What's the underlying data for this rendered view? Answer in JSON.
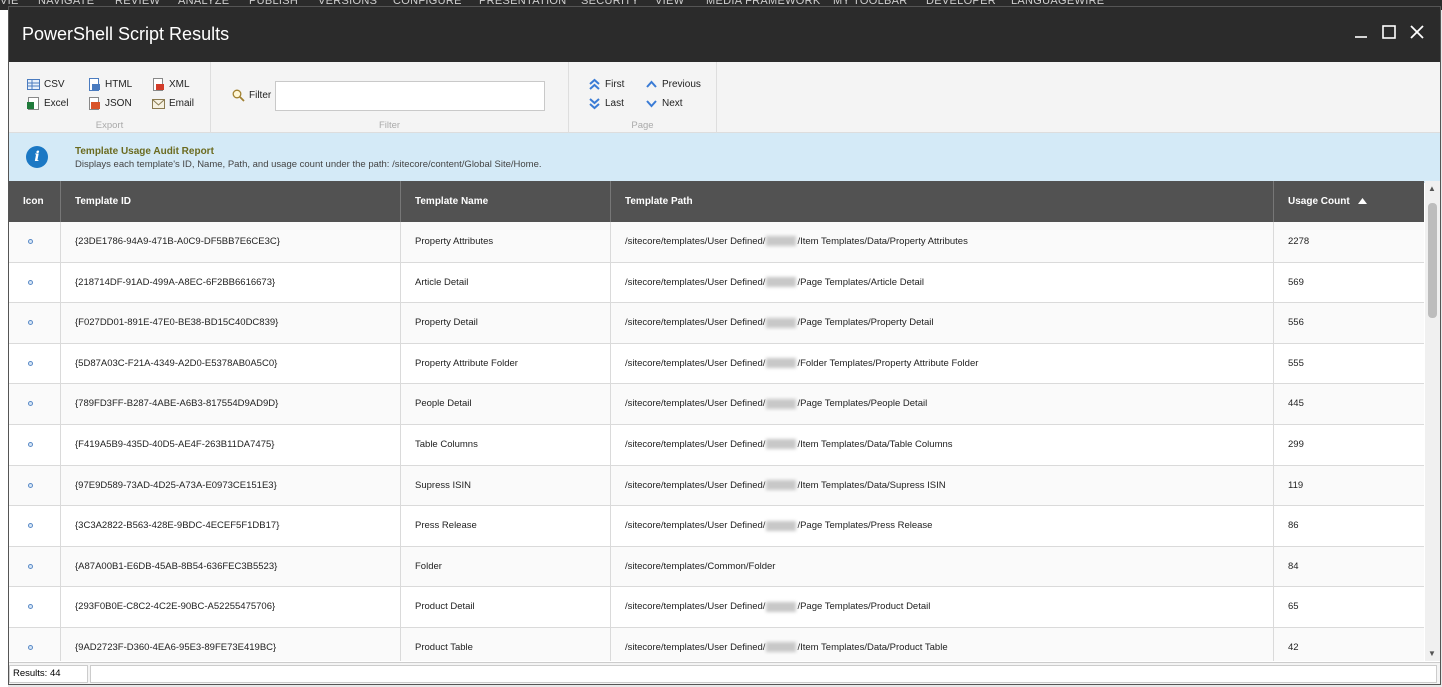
{
  "background_menu": [
    "VIE",
    "NAVIGATE",
    "REVIEW",
    "ANALYZE",
    "PUBLISH",
    "VERSIONS",
    "CONFIGURE",
    "PRESENTATION",
    "SECURITY",
    "VIEW",
    "MEDIA FRAMEWORK",
    "MY TOOLBAR",
    "DEVELOPER",
    "LANGUAGEWIRE"
  ],
  "window": {
    "title": "PowerShell Script Results",
    "minimize_icon": "minimize-icon",
    "maximize_icon": "maximize-icon",
    "close_icon": "close-icon"
  },
  "toolbar": {
    "export": {
      "label": "Export",
      "buttons": [
        {
          "label": "CSV",
          "icon": "csv-icon"
        },
        {
          "label": "HTML",
          "icon": "html-icon"
        },
        {
          "label": "XML",
          "icon": "xml-icon"
        },
        {
          "label": "Excel",
          "icon": "excel-icon"
        },
        {
          "label": "JSON",
          "icon": "json-icon"
        },
        {
          "label": "Email",
          "icon": "email-icon"
        }
      ]
    },
    "filter": {
      "label": "Filter",
      "button_label": "Filter",
      "value": "",
      "placeholder": ""
    },
    "page": {
      "label": "Page",
      "first": "First",
      "last": "Last",
      "previous": "Previous",
      "next": "Next"
    }
  },
  "info": {
    "title": "Template Usage Audit Report",
    "description": "Displays each template's ID, Name, Path, and usage count under the path: /sitecore/content/Global Site/Home."
  },
  "grid": {
    "columns": [
      "Icon",
      "Template ID",
      "Template Name",
      "Template Path",
      "Usage Count"
    ],
    "sort_column": "Usage Count",
    "sort_direction": "ascending",
    "rows": [
      {
        "id": "{23DE1786-94A9-471B-A0C9-DF5BB7E6CE3C}",
        "name": "Property Attributes",
        "path_pre": "/sitecore/templates/User Defined/",
        "path_post": "/Item Templates/Data/Property Attributes",
        "redacted": true,
        "count": "2278"
      },
      {
        "id": "{218714DF-91AD-499A-A8EC-6F2BB6616673}",
        "name": "Article Detail",
        "path_pre": "/sitecore/templates/User Defined/",
        "path_post": "/Page Templates/Article Detail",
        "redacted": true,
        "count": "569"
      },
      {
        "id": "{F027DD01-891E-47E0-BE38-BD15C40DC839}",
        "name": "Property Detail",
        "path_pre": "/sitecore/templates/User Defined/",
        "path_post": "/Page Templates/Property Detail",
        "redacted": true,
        "count": "556"
      },
      {
        "id": "{5D87A03C-F21A-4349-A2D0-E5378AB0A5C0}",
        "name": "Property Attribute Folder",
        "path_pre": "/sitecore/templates/User Defined/",
        "path_post": "/Folder Templates/Property Attribute Folder",
        "redacted": true,
        "count": "555"
      },
      {
        "id": "{789FD3FF-B287-4ABE-A6B3-817554D9AD9D}",
        "name": "People Detail",
        "path_pre": "/sitecore/templates/User Defined/",
        "path_post": "/Page Templates/People Detail",
        "redacted": true,
        "count": "445"
      },
      {
        "id": "{F419A5B9-435D-40D5-AE4F-263B11DA7475}",
        "name": "Table Columns",
        "path_pre": "/sitecore/templates/User Defined/",
        "path_post": "/Item Templates/Data/Table Columns",
        "redacted": true,
        "count": "299"
      },
      {
        "id": "{97E9D589-73AD-4D25-A73A-E0973CE151E3}",
        "name": "Supress ISIN",
        "path_pre": "/sitecore/templates/User Defined/",
        "path_post": "/Item Templates/Data/Supress ISIN",
        "redacted": true,
        "count": "119"
      },
      {
        "id": "{3C3A2822-B563-428E-9BDC-4ECEF5F1DB17}",
        "name": "Press Release",
        "path_pre": "/sitecore/templates/User Defined/",
        "path_post": "/Page Templates/Press Release",
        "redacted": true,
        "count": "86"
      },
      {
        "id": "{A87A00B1-E6DB-45AB-8B54-636FEC3B5523}",
        "name": "Folder",
        "path_pre": "/sitecore/templates/Common/Folder",
        "path_post": "",
        "redacted": false,
        "count": "84"
      },
      {
        "id": "{293F0B0E-C8C2-4C2E-90BC-A52255475706}",
        "name": "Product Detail",
        "path_pre": "/sitecore/templates/User Defined/",
        "path_post": "/Page Templates/Product Detail",
        "redacted": true,
        "count": "65"
      },
      {
        "id": "{9AD2723F-D360-4EA6-95E3-89FE73E419BC}",
        "name": "Product Table",
        "path_pre": "/sitecore/templates/User Defined/",
        "path_post": "/Item Templates/Data/Product Table",
        "redacted": true,
        "count": "42"
      }
    ]
  },
  "status": {
    "results_label": "Results: 44"
  }
}
